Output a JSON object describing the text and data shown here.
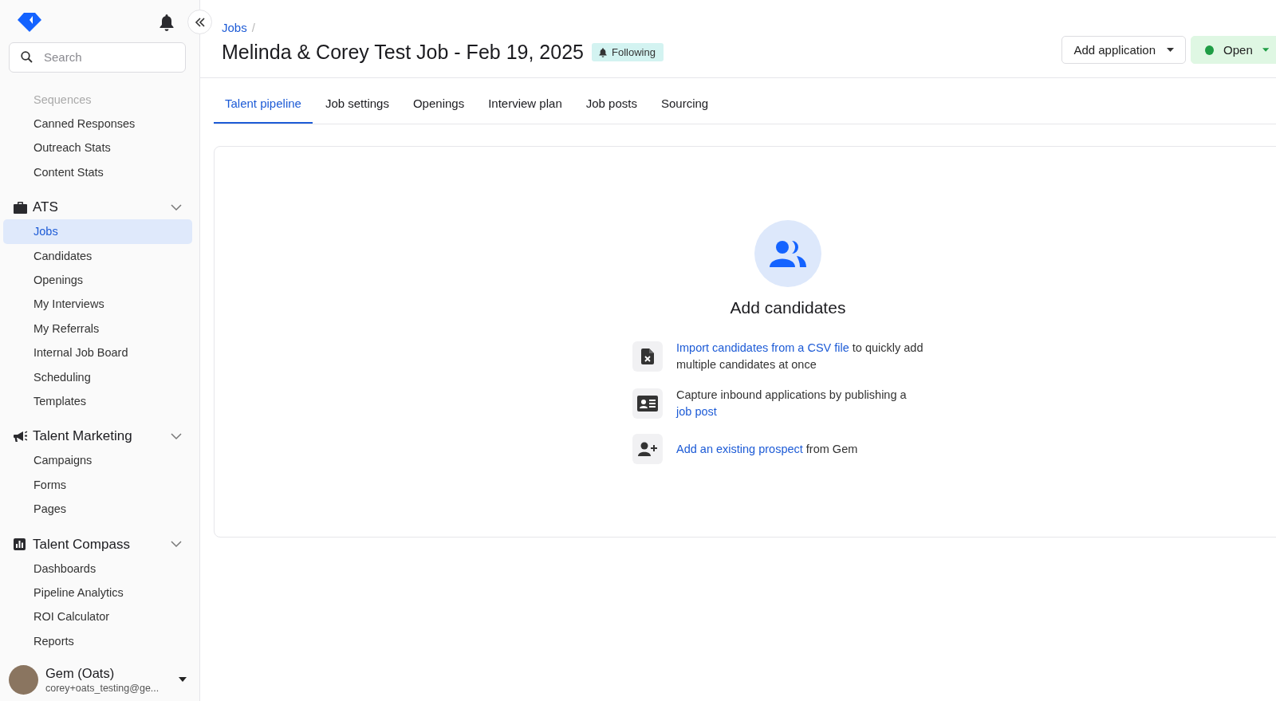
{
  "sidebar": {
    "search": {
      "placeholder": "Search"
    },
    "sections": [
      {
        "kind": "plain",
        "items": [
          {
            "label": "Sequences",
            "selected": false
          },
          {
            "label": "Canned Responses",
            "selected": false
          },
          {
            "label": "Outreach Stats",
            "selected": false
          },
          {
            "label": "Content Stats",
            "selected": false
          }
        ]
      },
      {
        "kind": "briefcase",
        "title": "ATS",
        "expanded": true,
        "items": [
          {
            "label": "Jobs",
            "selected": true
          },
          {
            "label": "Candidates",
            "selected": false
          },
          {
            "label": "Openings",
            "selected": false
          },
          {
            "label": "My Interviews",
            "selected": false
          },
          {
            "label": "My Referrals",
            "selected": false
          },
          {
            "label": "Internal Job Board",
            "selected": false
          },
          {
            "label": "Scheduling",
            "selected": false
          },
          {
            "label": "Templates",
            "selected": false
          }
        ]
      },
      {
        "kind": "megaphone",
        "title": "Talent Marketing",
        "expanded": true,
        "items": [
          {
            "label": "Campaigns",
            "selected": false
          },
          {
            "label": "Forms",
            "selected": false
          },
          {
            "label": "Pages",
            "selected": false
          }
        ]
      },
      {
        "kind": "chart",
        "title": "Talent Compass",
        "expanded": true,
        "items": [
          {
            "label": "Dashboards",
            "selected": false
          },
          {
            "label": "Pipeline Analytics",
            "selected": false
          },
          {
            "label": "ROI Calculator",
            "selected": false
          },
          {
            "label": "Reports",
            "selected": false
          }
        ]
      }
    ],
    "user": {
      "name": "Gem (Oats)",
      "email": "corey+oats_testing@ge..."
    }
  },
  "header": {
    "breadcrumb": {
      "items": [
        "Jobs"
      ],
      "separator": "/"
    },
    "title": "Melinda & Corey Test Job - Feb 19, 2025",
    "badge": "Following",
    "actions": [
      {
        "kind": "dropdown",
        "label": "Add application"
      },
      {
        "kind": "status",
        "label": "Open",
        "color": "#1f9d45"
      }
    ]
  },
  "tabs": [
    {
      "label": "Talent pipeline",
      "selected": true
    },
    {
      "label": "Job settings",
      "selected": false
    },
    {
      "label": "Openings",
      "selected": false
    },
    {
      "label": "Interview plan",
      "selected": false
    },
    {
      "label": "Job posts",
      "selected": false
    },
    {
      "label": "Sourcing",
      "selected": false
    }
  ],
  "empty_state": {
    "title": "Add candidates",
    "items": [
      {
        "kind": "csv",
        "parts": [
          {
            "text": "Import candidates from a CSV file",
            "link": true
          },
          {
            "text": " to quickly add multiple candidates at once",
            "link": false
          }
        ]
      },
      {
        "kind": "card",
        "parts": [
          {
            "text": "Capture inbound applications by publishing a ",
            "link": false
          },
          {
            "text": "job post",
            "link": true
          }
        ]
      },
      {
        "kind": "person",
        "parts": [
          {
            "text": "Add an existing prospect",
            "link": true
          },
          {
            "text": " from Gem",
            "link": false
          }
        ]
      }
    ]
  }
}
